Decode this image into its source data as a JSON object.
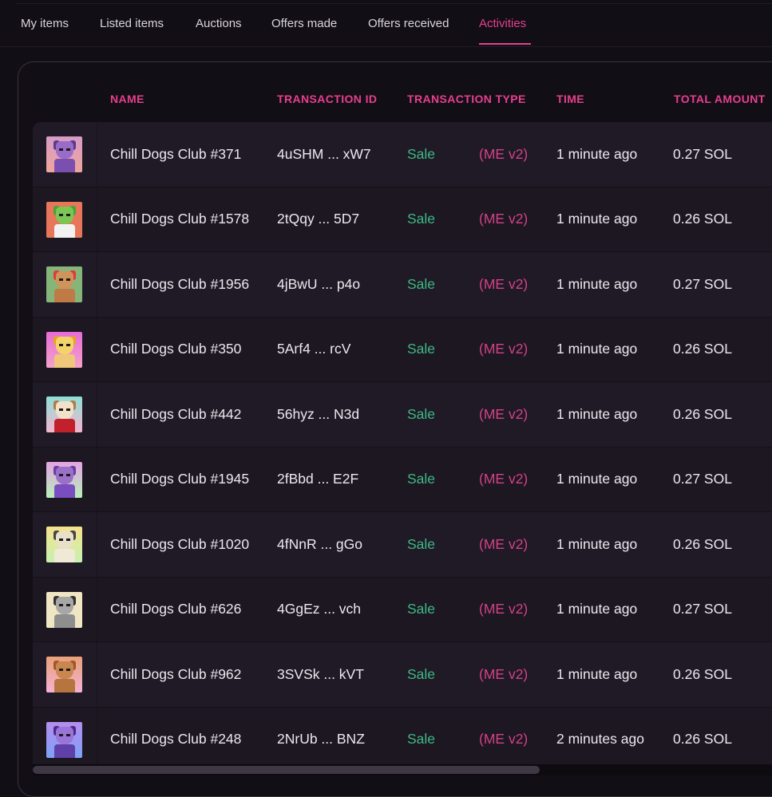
{
  "tabs": [
    {
      "label": "My items"
    },
    {
      "label": "Listed items"
    },
    {
      "label": "Auctions"
    },
    {
      "label": "Offers made"
    },
    {
      "label": "Offers received"
    },
    {
      "label": "Activities",
      "active": true
    }
  ],
  "table": {
    "headers": [
      "NAME",
      "TRANSACTION ID",
      "TRANSACTION TYPE",
      "TIME",
      "TOTAL AMOUNT"
    ],
    "rows": [
      {
        "name": "Chill Dogs Club #371",
        "tx": "4uSHM ... xW7",
        "type": "Sale",
        "market": "(ME v2)",
        "time": "1 minute ago",
        "amount": "0.27 SOL",
        "thumb_icon": "dog-nft-thumbnail"
      },
      {
        "name": "Chill Dogs Club #1578",
        "tx": "2tQqy ... 5D7",
        "type": "Sale",
        "market": "(ME v2)",
        "time": "1 minute ago",
        "amount": "0.26 SOL",
        "thumb_icon": "dog-nft-thumbnail"
      },
      {
        "name": "Chill Dogs Club #1956",
        "tx": "4jBwU ... p4o",
        "type": "Sale",
        "market": "(ME v2)",
        "time": "1 minute ago",
        "amount": "0.27 SOL",
        "thumb_icon": "dog-nft-thumbnail"
      },
      {
        "name": "Chill Dogs Club #350",
        "tx": "5Arf4 ... rcV",
        "type": "Sale",
        "market": "(ME v2)",
        "time": "1 minute ago",
        "amount": "0.26 SOL",
        "thumb_icon": "dog-nft-thumbnail"
      },
      {
        "name": "Chill Dogs Club #442",
        "tx": "56hyz ... N3d",
        "type": "Sale",
        "market": "(ME v2)",
        "time": "1 minute ago",
        "amount": "0.26 SOL",
        "thumb_icon": "dog-nft-thumbnail"
      },
      {
        "name": "Chill Dogs Club #1945",
        "tx": "2fBbd ... E2F",
        "type": "Sale",
        "market": "(ME v2)",
        "time": "1 minute ago",
        "amount": "0.27 SOL",
        "thumb_icon": "dog-nft-thumbnail"
      },
      {
        "name": "Chill Dogs Club #1020",
        "tx": "4fNnR ... gGo",
        "type": "Sale",
        "market": "(ME v2)",
        "time": "1 minute ago",
        "amount": "0.26 SOL",
        "thumb_icon": "dog-nft-thumbnail"
      },
      {
        "name": "Chill Dogs Club #626",
        "tx": "4GgEz ... vch",
        "type": "Sale",
        "market": "(ME v2)",
        "time": "1 minute ago",
        "amount": "0.27 SOL",
        "thumb_icon": "dog-nft-thumbnail"
      },
      {
        "name": "Chill Dogs Club #962",
        "tx": "3SVSk ... kVT",
        "type": "Sale",
        "market": "(ME v2)",
        "time": "1 minute ago",
        "amount": "0.26 SOL",
        "thumb_icon": "dog-nft-thumbnail"
      },
      {
        "name": "Chill Dogs Club #248",
        "tx": "2NrUb ... BNZ",
        "type": "Sale",
        "market": "(ME v2)",
        "time": "2 minutes ago",
        "amount": "0.26 SOL",
        "thumb_icon": "dog-nft-thumbnail"
      }
    ]
  },
  "colors": {
    "accent": "#e63f8e",
    "sale_green": "#3fb885",
    "market_pink": "#d44189",
    "background": "#120e16",
    "row_bg": "#1f1a25"
  },
  "scrollbar": {
    "horizontal_position_fraction": 0.0,
    "visible_fraction": 0.69
  }
}
